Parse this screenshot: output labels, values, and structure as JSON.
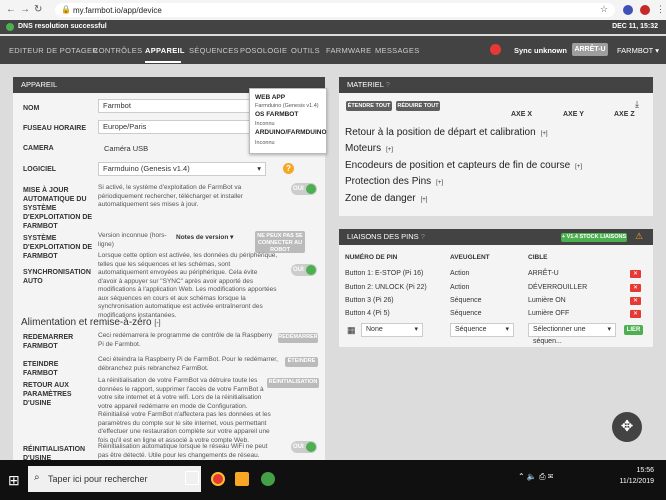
{
  "browser": {
    "url": "my.farmbot.io/app/device"
  },
  "topbar": {
    "status": "DNS resolution successful",
    "date": "DEC 11, 15:32"
  },
  "nav": {
    "tabs": [
      "EDITEUR DE POTAGER",
      "CONTRÔLES",
      "APPAREIL",
      "SÉQUENCES",
      "POSOLOGIE",
      "OUTILS",
      "FARMWARE",
      "MESSAGES"
    ],
    "sync": "Sync unknown",
    "estop": "ARRÊT-U",
    "account": "FARMBOT"
  },
  "device": {
    "title": "APPAREIL",
    "name_label": "NOM",
    "name_value": "Farmbot",
    "timezone_label": "FUSEAU HORAIRE",
    "timezone_value": "Europe/Paris",
    "camera_label": "CAMERA",
    "camera_value": "Caméra USB",
    "firmware_label": "LOGICIEL",
    "firmware_value": "Farmduino (Genesis v1.4)",
    "auto_update_label": "MISE À JOUR AUTOMATIQUE DU SYSTÈME D'EXPLOITATION DE FARMBOT",
    "auto_update_desc": "Si activé, le système d'exploitation de FarmBot va périodiquement rechercher, télécharger et installer automatiquement ses mises à jour.",
    "os_label": "SYSTÈME D'EXPLOITATION DE FARMBOT",
    "os_version": "Version inconnue (hors-ligne)",
    "release_notes": "Notes de version ▾",
    "os_button": "NE PEUX PAS SE CONNECTER AU ROBOT",
    "autosync_label": "SYNCHRONISATION AUTO",
    "autosync_desc": "Lorsque cette option est activée, les données du périphérique, telles que les séquences et les schémas, sont automatiquement envoyées au périphérique. Cela évite d'avoir à appuyer sur \"SYNC\" après avoir apporté des modifications à l'application Web. Les modifications apportées aux séquences en cours et aux schémas lorsque la synchronisation automatique est activée entraîneront des modifications instantanées.",
    "toggle_on": "OUI",
    "power_title": "Alimentation et remise-à-zéro",
    "restart_label": "REDEMARRER FARMBOT",
    "restart_desc": "Ceci redémarrera le programme de contrôle de la Raspberry Pi de Farmbot.",
    "restart_button": "REDÉMARRER",
    "shutdown_label": "ETEINDRE FARMBOT",
    "shutdown_desc": "Ceci éteindra la Raspberry Pi de FarmBot. Pour le redémarrer, débranchez puis rebranchez FarmBot.",
    "shutdown_button": "ÉTEINDRE",
    "factory_label": "RETOUR AUX PARAMÈTRES D'USINE",
    "factory_desc": "La réinitialisation de votre FarmBot va détruire toute les données le rapport, supprimer l'accès de votre FarmBot à votre site internet et à votre wifi. Lors de la réinitialisation votre appareil redémarre en mode de Configuration. Réinitialisé votre FarmBot n'affectera pas les données et les paramètres du compte sur le site internet, vous permettant d'effectuer une restauration complète sur votre appareil une fois qu'il est en ligne et associé à votre compte Web.",
    "factory_button": "RÉINITIALISATION",
    "auto_factory_label": "RÉINITIALISATION D'USINE",
    "auto_factory_desc": "Réinitialisation automatique lorsque le réseau WiFi ne peut pas être détecté. Utile pour les changements de réseau."
  },
  "popup": {
    "webapp_h": "WEB APP",
    "webapp_v": "Farmduino (Genesis v1.4)",
    "os_h": "OS FARMBOT",
    "os_v": "Inconnu",
    "fw_h": "ARDUINO/FARMDUINO",
    "fw_v": "Inconnu"
  },
  "hardware": {
    "title": "MATERIEL",
    "expand": "ÉTENDRE TOUT",
    "collapse": "RÉDUIRE TOUT",
    "axes": [
      "AXE X",
      "AXE Y",
      "AXE Z"
    ],
    "sections": [
      "Retour à la position de départ et calibration",
      "Moteurs",
      "Encodeurs de position et capteurs de fin de course",
      "Protection des Pins",
      "Zone de danger"
    ]
  },
  "pins": {
    "title": "LIAISONS DES PINS",
    "stock_button": "+ V1.4 STOCK LIAISONS",
    "headers": [
      "NUMÉRO DE PIN",
      "AVEUGLENT",
      "CIBLE"
    ],
    "rows": [
      [
        "Button 1: E-STOP (Pi 16)",
        "Action",
        "ARRÊT-U"
      ],
      [
        "Button 2: UNLOCK (Pi 22)",
        "Action",
        "DÉVERROUILLER"
      ],
      [
        "Button 3 (Pi 26)",
        "Séquence",
        "Lumière ON"
      ],
      [
        "Button 4 (Pi 5)",
        "Séquence",
        "Lumière OFF"
      ]
    ],
    "sel_pin": "None",
    "sel_type": "Séquence",
    "sel_target": "Sélectionner une séquen...",
    "bind_button": "LIER"
  },
  "taskbar": {
    "search_placeholder": "Taper ici pour rechercher",
    "time": "15:56",
    "date": "11/12/2019"
  }
}
